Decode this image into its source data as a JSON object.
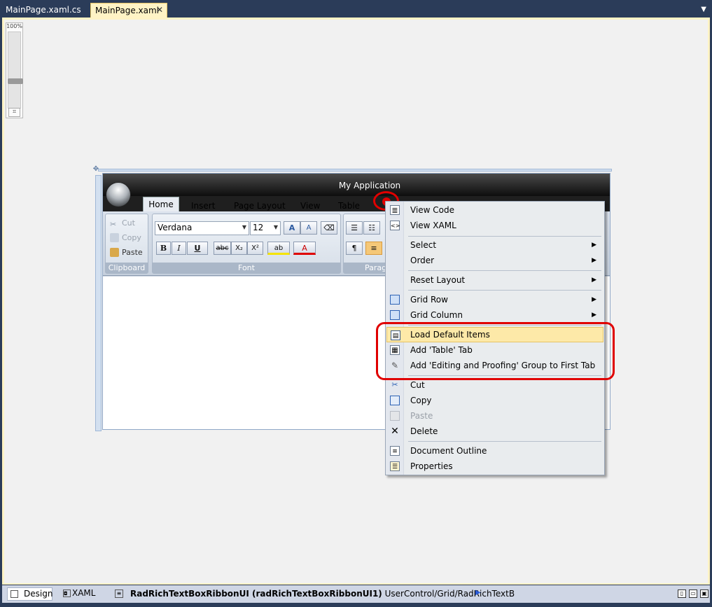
{
  "tabs": [
    {
      "label": "MainPage.xaml.cs",
      "active": false
    },
    {
      "label": "MainPage.xaml",
      "active": true
    }
  ],
  "tab_close": "✕",
  "zoom": {
    "label": "100%"
  },
  "app": {
    "title": "My Application",
    "ribbon_tabs": [
      "Home",
      "Insert",
      "Page Layout",
      "View",
      "Table"
    ],
    "groups": {
      "clipboard": {
        "label": "Clipboard",
        "cut": "Cut",
        "copy": "Copy",
        "paste": "Paste"
      },
      "font": {
        "label": "Font",
        "font_name": "Verdana",
        "font_size": "12"
      },
      "paragraph": {
        "label": "Parag"
      }
    },
    "font_buttons": {
      "bold": "B",
      "italic": "I",
      "underline": "U",
      "strike": "abc",
      "subscript": "X₂",
      "superscript": "X²",
      "highlight": "ab",
      "font_color": "A",
      "grow": "A",
      "shrink": "A",
      "pilcrow": "¶"
    }
  },
  "context_menu": {
    "items": [
      {
        "label": "View Code",
        "icon": "code-icon"
      },
      {
        "label": "View XAML",
        "icon": "xaml-icon"
      },
      {
        "label": "Select",
        "submenu": true
      },
      {
        "label": "Order",
        "submenu": true
      },
      {
        "label": "Reset Layout",
        "submenu": true
      },
      {
        "label": "Grid Row",
        "submenu": true,
        "icon": "grid-row-icon"
      },
      {
        "label": "Grid Column",
        "submenu": true,
        "icon": "grid-column-icon"
      },
      {
        "label": "Load Default Items",
        "icon": "ribbon-icon",
        "highlighted": true
      },
      {
        "label": "Add 'Table' Tab",
        "icon": "table-icon"
      },
      {
        "label": "Add 'Editing and Proofing' Group to First Tab",
        "icon": "editing-icon"
      },
      {
        "label": "Cut",
        "icon": "scissors-icon"
      },
      {
        "label": "Copy",
        "icon": "copy-icon"
      },
      {
        "label": "Paste",
        "icon": "paste-icon",
        "disabled": true
      },
      {
        "label": "Delete",
        "icon": "delete-icon"
      },
      {
        "label": "Document Outline",
        "icon": "outline-icon"
      },
      {
        "label": "Properties",
        "icon": "properties-icon"
      }
    ]
  },
  "bottom": {
    "design_tab": "Design",
    "xaml_tab": "XAML",
    "crumb_bold": "RadRichTextBoxRibbonUI (radRichTextBoxRibbonUI1)",
    "crumb_path": "UserControl/Grid/RadRichTextB"
  },
  "colors": {
    "annotation": "#e00000",
    "highlight": "#fde9a8",
    "chrome": "#2b3c59"
  }
}
